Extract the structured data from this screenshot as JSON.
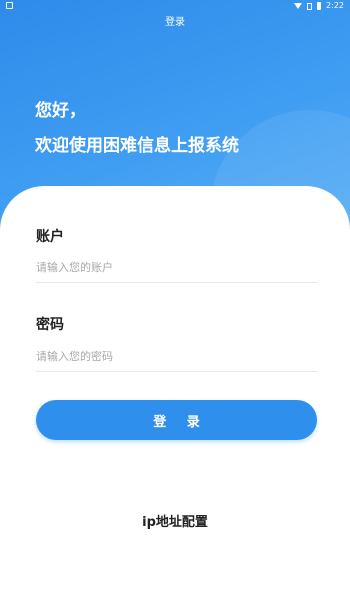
{
  "status_bar": {
    "time": "2:22"
  },
  "nav": {
    "title": "登录"
  },
  "greeting": {
    "line1": "您好，",
    "line2": "欢迎使用困难信息上报系统"
  },
  "form": {
    "account": {
      "label": "账户",
      "placeholder": "请输入您的账户"
    },
    "password": {
      "label": "密码",
      "placeholder": "请输入您的密码"
    },
    "submit_label": "登 录"
  },
  "footer": {
    "ip_config_label": "ip地址配置"
  },
  "colors": {
    "primary": "#2f8fec",
    "hero_start": "#2e8bea",
    "hero_end": "#58aef5"
  }
}
